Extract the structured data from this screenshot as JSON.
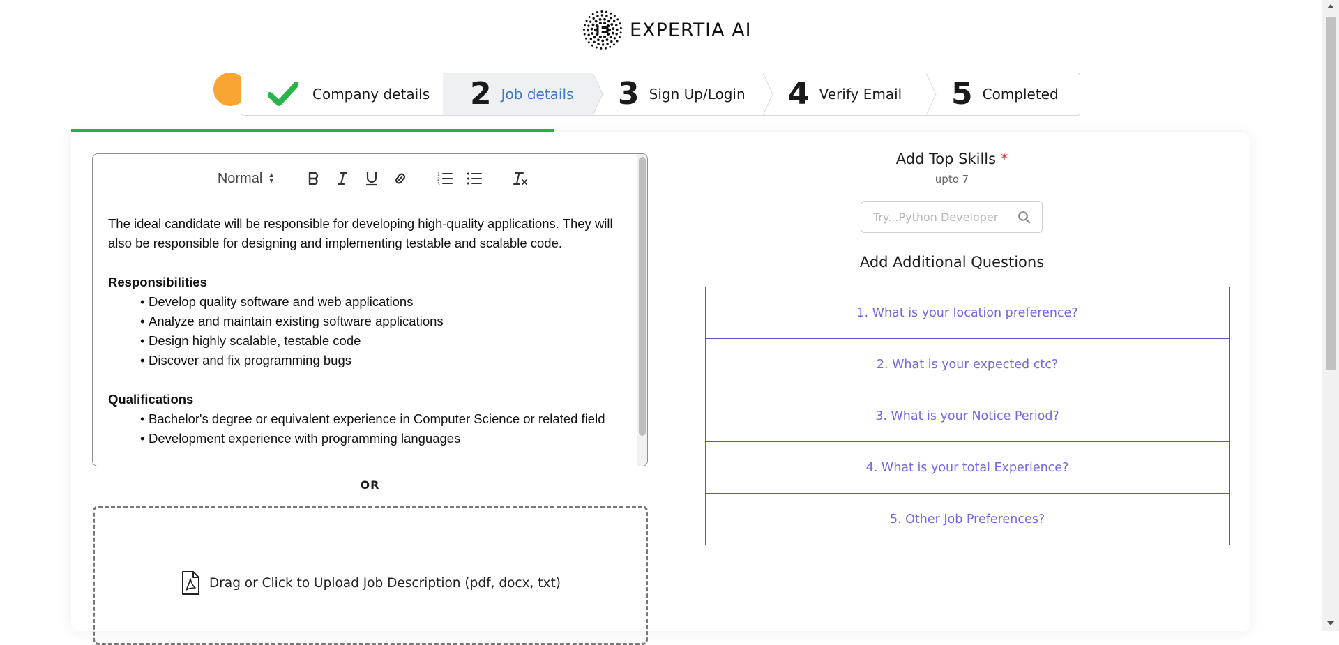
{
  "brand": {
    "name": "EXPERTIA AI",
    "logo_icon": "expertia-logo-icon"
  },
  "colors": {
    "accent_green": "#27b54b",
    "orange": "#f8a534",
    "step_active": "#3a79c9",
    "question_purple": "#7367e6",
    "question_border": "#5b4fd4",
    "required_red": "#e02020"
  },
  "progress": {
    "fraction": 0.41
  },
  "steps": [
    {
      "number": "",
      "label": "Company details",
      "state": "done",
      "icon": "check-icon"
    },
    {
      "number": "2",
      "label": "Job details",
      "state": "active"
    },
    {
      "number": "3",
      "label": "Sign Up/Login",
      "state": "pending"
    },
    {
      "number": "4",
      "label": "Verify Email",
      "state": "pending"
    },
    {
      "number": "5",
      "label": "Completed",
      "state": "pending"
    }
  ],
  "editor": {
    "toolbar": {
      "heading": "Normal",
      "tools": [
        "bold-icon",
        "italic-icon",
        "underline-icon",
        "link-icon",
        "ordered-list-icon",
        "bullet-list-icon",
        "clear-format-icon"
      ]
    },
    "intro": "The ideal candidate will be responsible for developing high-quality applications. They will also be responsible for designing and implementing testable and scalable code.",
    "responsibilities_heading": "Responsibilities",
    "responsibilities": [
      "Develop quality software and web applications",
      "Analyze and maintain existing software applications",
      "Design highly scalable, testable code",
      "Discover and fix programming bugs"
    ],
    "qualifications_heading": "Qualifications",
    "qualifications": [
      "Bachelor's degree or equivalent experience in Computer Science or related field",
      "Development experience with programming languages"
    ]
  },
  "divider": {
    "text": "OR"
  },
  "upload": {
    "text": "Drag or Click to Upload Job Description (pdf, docx, txt)",
    "icon": "pdf-file-icon"
  },
  "skills": {
    "title": "Add Top Skills",
    "required_mark": "*",
    "subtitle": "upto 7",
    "search_placeholder": "Try...Python Developer",
    "search_value": "",
    "icon": "search-icon"
  },
  "questions": {
    "title": "Add Additional Questions",
    "items": [
      "1. What is your location preference?",
      "2. What is your expected ctc?",
      "3. What is your Notice Period?",
      "4. What is your total Experience?",
      "5. Other Job Preferences?"
    ]
  }
}
